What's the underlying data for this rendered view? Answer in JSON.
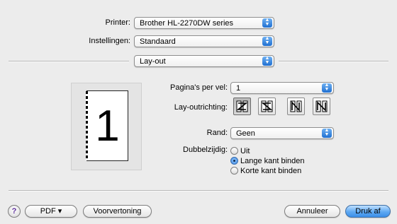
{
  "printer": {
    "label": "Printer:",
    "value": "Brother HL-2270DW series"
  },
  "settings": {
    "label": "Instellingen:",
    "value": "Standaard"
  },
  "panel": {
    "value": "Lay-out"
  },
  "pages_per_sheet": {
    "label": "Pagina's per vel:",
    "value": "1"
  },
  "layout_direction": {
    "label": "Lay-outrichting:",
    "options": [
      "Z",
      "S",
      "N-reversed",
      "N"
    ],
    "selected": 0
  },
  "border": {
    "label": "Rand:",
    "value": "Geen"
  },
  "duplex": {
    "label": "Dubbelzijdig:",
    "options": [
      "Uit",
      "Lange kant binden",
      "Korte kant binden"
    ],
    "selected": 1
  },
  "preview": {
    "page_number": "1"
  },
  "buttons": {
    "help": "?",
    "pdf": "PDF ▾",
    "preview": "Voorvertoning",
    "cancel": "Annuleer",
    "print": "Druk af"
  },
  "colors": {
    "accent": "#3b8ee8",
    "background": "#ececec"
  },
  "icons": {
    "popup_arrow": "updown-arrow-icon",
    "help": "help-icon"
  }
}
